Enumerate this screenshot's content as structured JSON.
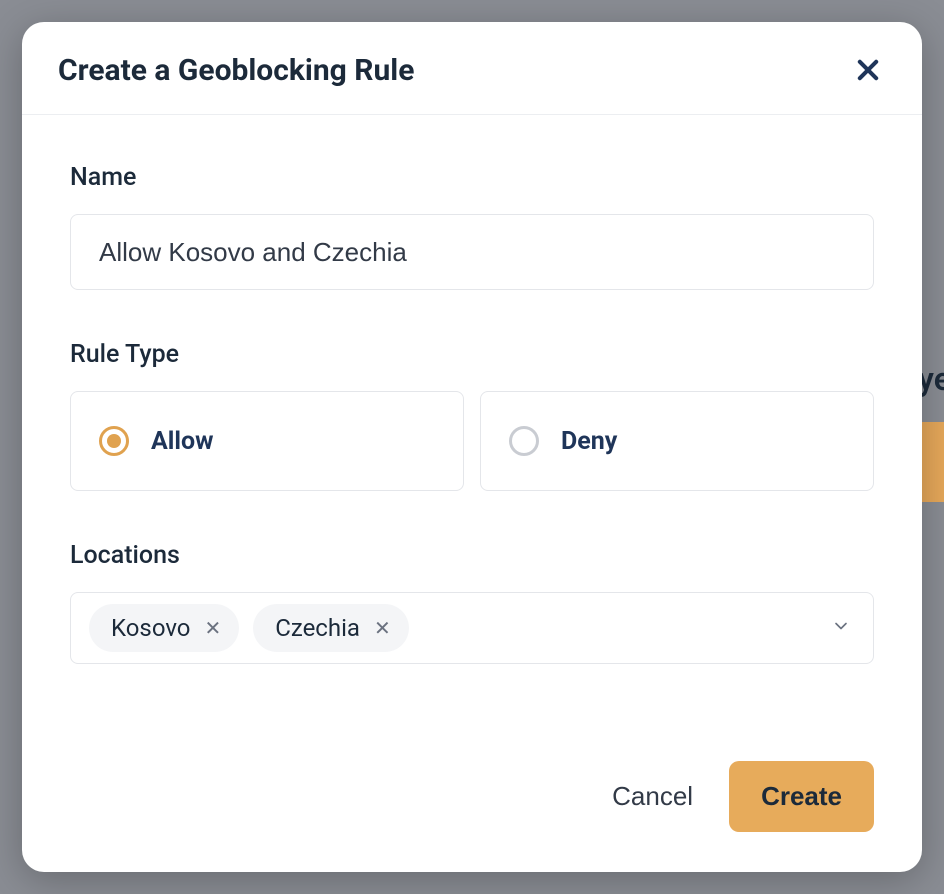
{
  "modal": {
    "title": "Create a Geoblocking Rule",
    "fields": {
      "name": {
        "label": "Name",
        "value": "Allow Kosovo and Czechia"
      },
      "rule_type": {
        "label": "Rule Type",
        "options": {
          "allow": "Allow",
          "deny": "Deny"
        },
        "selected": "allow"
      },
      "locations": {
        "label": "Locations",
        "chips": [
          "Kosovo",
          "Czechia"
        ]
      }
    },
    "footer": {
      "cancel": "Cancel",
      "create": "Create"
    }
  },
  "backdrop": {
    "text_fragment": "ye"
  }
}
